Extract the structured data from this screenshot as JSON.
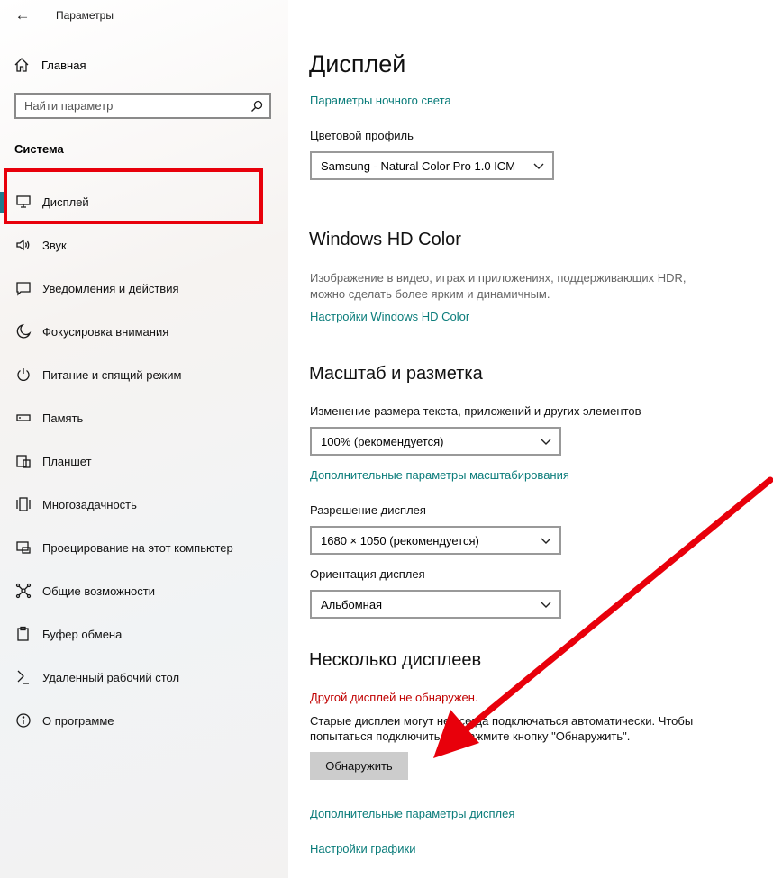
{
  "app": {
    "title": "Параметры"
  },
  "sidebar": {
    "home_label": "Главная",
    "search_placeholder": "Найти параметр",
    "section_title": "Система",
    "items": [
      {
        "label": "Дисплей",
        "icon": "monitor-icon",
        "active": true
      },
      {
        "label": "Звук",
        "icon": "speaker-icon"
      },
      {
        "label": "Уведомления и действия",
        "icon": "notifications-icon"
      },
      {
        "label": "Фокусировка внимания",
        "icon": "moon-icon"
      },
      {
        "label": "Питание и спящий режим",
        "icon": "power-icon"
      },
      {
        "label": "Память",
        "icon": "storage-icon"
      },
      {
        "label": "Планшет",
        "icon": "tablet-icon"
      },
      {
        "label": "Многозадачность",
        "icon": "multitasking-icon"
      },
      {
        "label": "Проецирование на этот компьютер",
        "icon": "projection-icon"
      },
      {
        "label": "Общие возможности",
        "icon": "shared-experiences-icon"
      },
      {
        "label": "Буфер обмена",
        "icon": "clipboard-icon"
      },
      {
        "label": "Удаленный рабочий стол",
        "icon": "remote-desktop-icon"
      },
      {
        "label": "О программе",
        "icon": "info-icon"
      }
    ]
  },
  "main": {
    "title": "Дисплей",
    "night_light_link": "Параметры ночного света",
    "color_profile": {
      "label": "Цветовой профиль",
      "value": "Samsung - Natural Color Pro 1.0 ICM"
    },
    "hd_color": {
      "title": "Windows HD Color",
      "desc": "Изображение в видео, играх и приложениях, поддерживающих HDR, можно сделать более ярким и динамичным.",
      "link": "Настройки Windows HD Color"
    },
    "scale": {
      "title": "Масштаб и разметка",
      "size_label": "Изменение размера текста, приложений и других элементов",
      "size_value": "100% (рекомендуется)",
      "advanced_link": "Дополнительные параметры масштабирования",
      "resolution_label": "Разрешение дисплея",
      "resolution_value": "1680 × 1050 (рекомендуется)",
      "orientation_label": "Ориентация дисплея",
      "orientation_value": "Альбомная"
    },
    "multi": {
      "title": "Несколько дисплеев",
      "warning": "Другой дисплей не обнаружен.",
      "text": "Старые дисплеи могут не всегда подключаться автоматически. Чтобы попытаться подключить их, нажмите кнопку \"Обнаружить\".",
      "detect_button": "Обнаружить"
    },
    "advanced_display_link": "Дополнительные параметры дисплея",
    "graphics_link": "Настройки графики"
  },
  "colors": {
    "accent": "#0a7c7a",
    "highlight": "#e8000b",
    "warning": "#c00000"
  }
}
